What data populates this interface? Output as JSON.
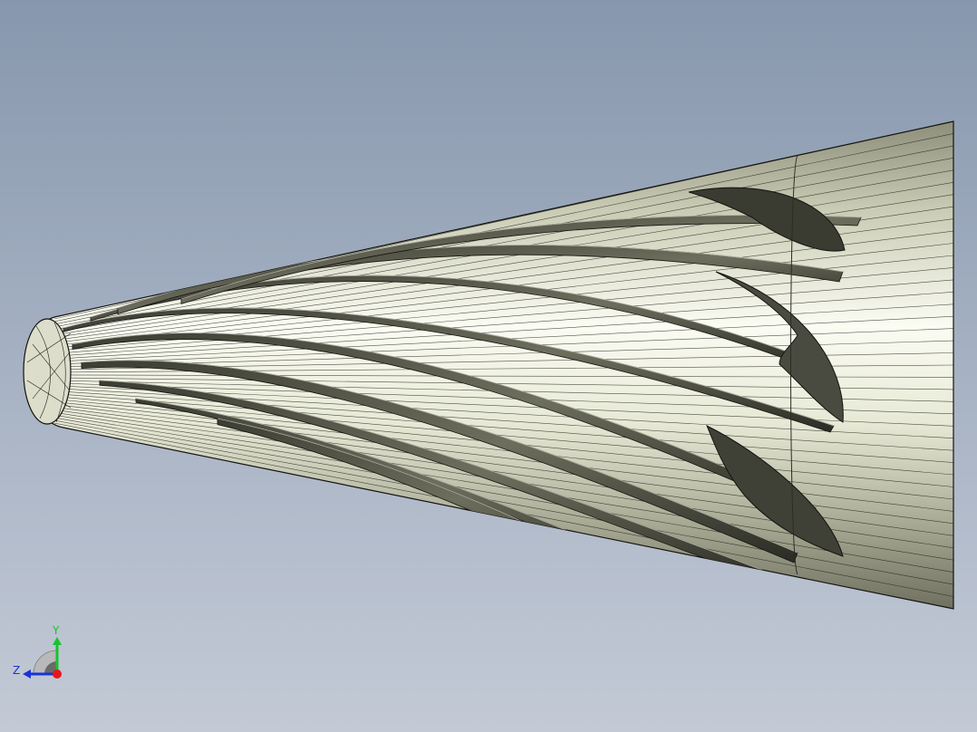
{
  "viewport": {
    "background_top": "#8797ad",
    "background_bottom": "#c3cad6",
    "model_fill_light": "#fbfcf2",
    "model_fill_mid": "#c9cbb4",
    "model_fill_dark": "#6f705f",
    "edge_color": "#141410",
    "tool_name": "helical-fluted-drill-tip"
  },
  "triad": {
    "y_label": "Y",
    "z_label": "Z",
    "x_color": "#e8141b",
    "y_color": "#16c42a",
    "z_color": "#1833d6",
    "icon": "view-orientation-triad-icon"
  }
}
